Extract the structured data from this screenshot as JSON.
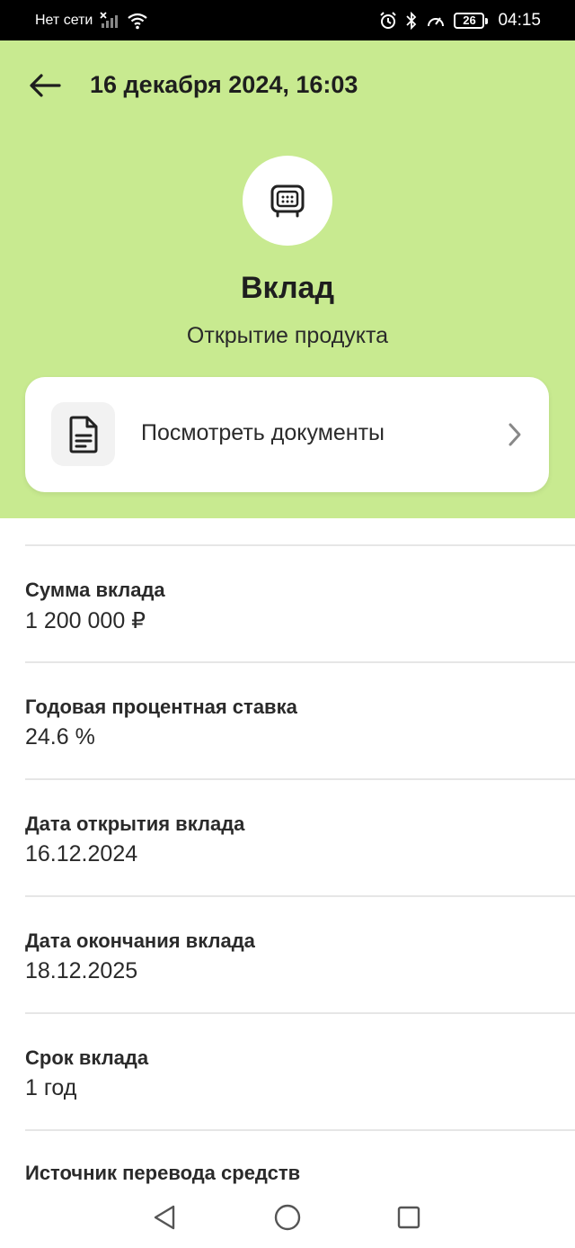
{
  "status_bar": {
    "network_text": "Нет сети",
    "battery_level": "26",
    "time": "04:15",
    "icons": [
      "signal-off-icon",
      "wifi-icon",
      "alarm-icon",
      "bluetooth-icon",
      "speedometer-icon",
      "battery-icon"
    ]
  },
  "header": {
    "title": "16 декабря 2024, 16:03",
    "back_icon": "arrow-left-icon"
  },
  "product": {
    "icon": "safe-icon",
    "title": "Вклад",
    "subtitle": "Открытие продукта"
  },
  "documents": {
    "label": "Посмотреть документы",
    "icon": "document-icon",
    "chevron_icon": "chevron-right-icon"
  },
  "details": [
    {
      "label": "Сумма вклада",
      "value": "1 200 000 ₽"
    },
    {
      "label": "Годовая процентная ставка",
      "value": "24.6 %"
    },
    {
      "label": "Дата открытия вклада",
      "value": "16.12.2024"
    },
    {
      "label": "Дата окончания вклада",
      "value": "18.12.2025"
    },
    {
      "label": "Срок вклада",
      "value": "1 год"
    },
    {
      "label": "Источник перевода средств",
      "value": ""
    }
  ],
  "nav": {
    "back_icon": "triangle-back-icon",
    "home_icon": "circle-home-icon",
    "recents_icon": "square-recents-icon"
  },
  "colors": {
    "hero_background": "#c8ea90",
    "card_background": "#ffffff",
    "divider": "#e6e6e6"
  }
}
